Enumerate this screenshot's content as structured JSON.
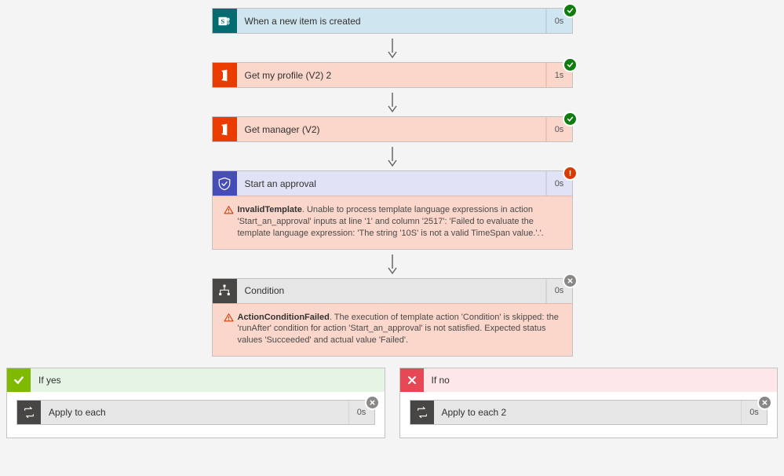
{
  "steps": {
    "trigger": {
      "title": "When a new item is created",
      "duration": "0s",
      "status": "ok"
    },
    "profile": {
      "title": "Get my profile (V2) 2",
      "duration": "1s",
      "status": "ok"
    },
    "manager": {
      "title": "Get manager (V2)",
      "duration": "0s",
      "status": "ok"
    },
    "approval": {
      "title": "Start an approval",
      "duration": "0s",
      "status": "error",
      "error_code": "InvalidTemplate",
      "error_msg": ". Unable to process template language expressions in action 'Start_an_approval' inputs at line '1' and column '2517': 'Failed to evaluate the template language expression: 'The string '10S' is not a valid TimeSpan value.'.'."
    },
    "condition": {
      "title": "Condition",
      "duration": "0s",
      "status": "skipped",
      "error_code": "ActionConditionFailed",
      "error_msg": ". The execution of template action 'Condition' is skipped: the 'runAfter' condition for action 'Start_an_approval' is not satisfied. Expected status values 'Succeeded' and actual value 'Failed'."
    }
  },
  "branches": {
    "yes": {
      "label": "If yes",
      "inner_title": "Apply to each",
      "inner_duration": "0s"
    },
    "no": {
      "label": "If no",
      "inner_title": "Apply to each 2",
      "inner_duration": "0s"
    }
  }
}
